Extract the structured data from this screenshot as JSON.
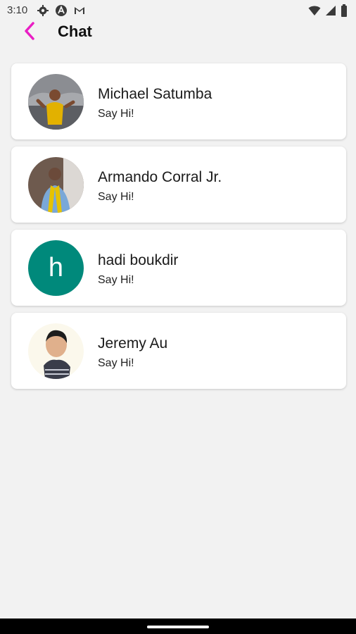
{
  "status_bar": {
    "time": "3:10",
    "icons": [
      "gear-icon",
      "a-circle-icon",
      "gmail-icon"
    ],
    "right_icons": [
      "wifi-icon",
      "signal-icon",
      "battery-icon"
    ]
  },
  "app_bar": {
    "title": "Chat",
    "back_icon": "chevron-left-icon",
    "accent_color": "#e91ec4"
  },
  "chats": [
    {
      "name": "Michael Satumba",
      "preview": "Say Hi!",
      "avatar_type": "photo"
    },
    {
      "name": "Armando Corral Jr.",
      "preview": "Say Hi!",
      "avatar_type": "photo"
    },
    {
      "name": "hadi boukdir",
      "preview": "Say Hi!",
      "avatar_type": "letter",
      "avatar_letter": "h",
      "avatar_color": "#00897b"
    },
    {
      "name": "Jeremy Au",
      "preview": "Say Hi!",
      "avatar_type": "photo"
    }
  ]
}
